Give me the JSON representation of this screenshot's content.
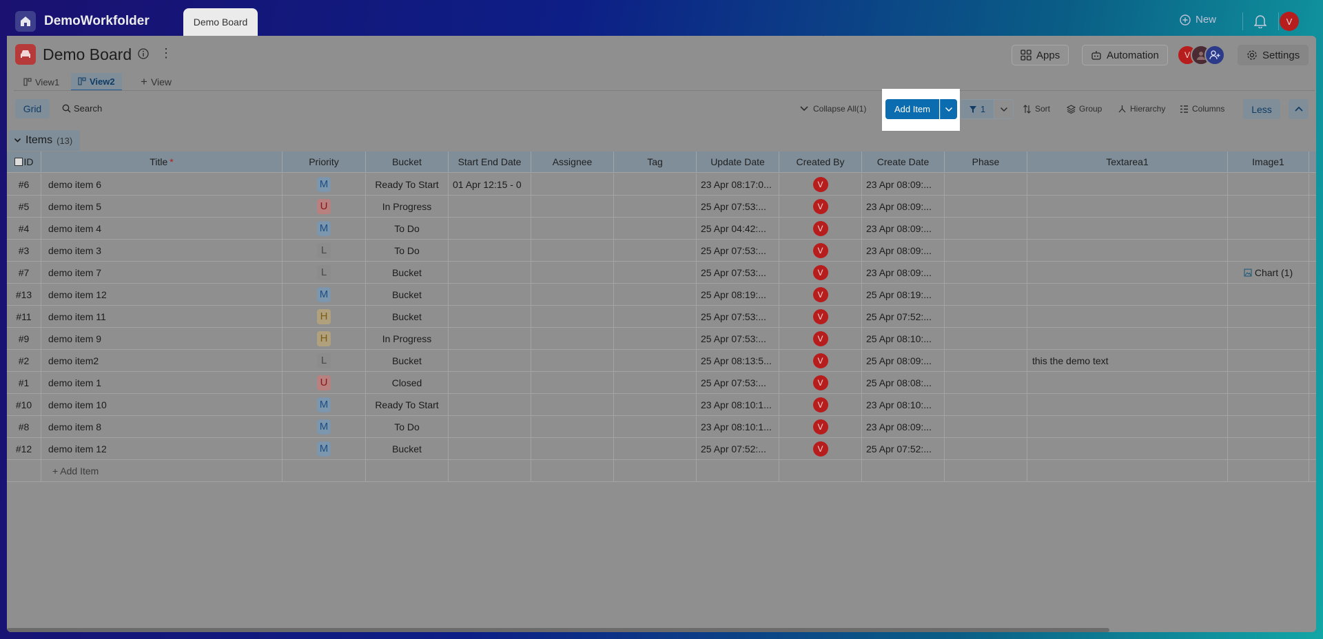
{
  "topbar": {
    "app_title": "DemoWorkfolder",
    "active_tab": "Demo Board",
    "new_label": "New",
    "avatar_letter": "V"
  },
  "board": {
    "title": "Demo Board",
    "apps_label": "Apps",
    "automation_label": "Automation",
    "settings_label": "Settings",
    "avatars": [
      "V",
      "",
      ""
    ]
  },
  "views": {
    "tabs": [
      {
        "label": "View1",
        "active": false
      },
      {
        "label": "View2",
        "active": true
      }
    ],
    "add_view_label": "View"
  },
  "toolbar": {
    "grid_label": "Grid",
    "search_label": "Search",
    "collapse_all_label": "Collapse All(1)",
    "add_item_label": "Add Item",
    "filter_count": "1",
    "sort_label": "Sort",
    "group_label": "Group",
    "hierarchy_label": "Hierarchy",
    "columns_label": "Columns",
    "less_label": "Less"
  },
  "group": {
    "name": "Items",
    "count": "(13)"
  },
  "table": {
    "columns": [
      "ID",
      "Title",
      "Priority",
      "Bucket",
      "Start End Date",
      "Assignee",
      "Tag",
      "Update Date",
      "Created By",
      "Create Date",
      "Phase",
      "Textarea1",
      "Image1"
    ],
    "title_required_mark": "*",
    "rows": [
      {
        "id": "#6",
        "title": "demo item 6",
        "priority": "M",
        "bucket": "Ready To Start",
        "date": "01 Apr 12:15  -  0",
        "update": "23 Apr 08:17:0...",
        "by": "V",
        "create": "23 Apr 08:09:...",
        "text": "",
        "image": ""
      },
      {
        "id": "#5",
        "title": "demo item 5",
        "priority": "U",
        "bucket": "In Progress",
        "date": "",
        "update": "25 Apr 07:53:...",
        "by": "V",
        "create": "23 Apr 08:09:...",
        "text": "",
        "image": ""
      },
      {
        "id": "#4",
        "title": "demo item 4",
        "priority": "M",
        "bucket": "To Do",
        "date": "",
        "update": "25 Apr 04:42:...",
        "by": "V",
        "create": "23 Apr 08:09:...",
        "text": "",
        "image": ""
      },
      {
        "id": "#3",
        "title": "demo item 3",
        "priority": "L",
        "bucket": "To Do",
        "date": "",
        "update": "25 Apr 07:53:...",
        "by": "V",
        "create": "23 Apr 08:09:...",
        "text": "",
        "image": ""
      },
      {
        "id": "#7",
        "title": "demo item 7",
        "priority": "L",
        "bucket": "Bucket",
        "date": "",
        "update": "25 Apr 07:53:...",
        "by": "V",
        "create": "23 Apr 08:09:...",
        "text": "",
        "image": "Chart (1)"
      },
      {
        "id": "#13",
        "title": "demo item 12",
        "priority": "M",
        "bucket": "Bucket",
        "date": "",
        "update": "25 Apr 08:19:...",
        "by": "V",
        "create": "25 Apr 08:19:...",
        "text": "",
        "image": ""
      },
      {
        "id": "#11",
        "title": "demo item 11",
        "priority": "H",
        "bucket": "Bucket",
        "date": "",
        "update": "25 Apr 07:53:...",
        "by": "V",
        "create": "25 Apr 07:52:...",
        "text": "",
        "image": ""
      },
      {
        "id": "#9",
        "title": "demo item 9",
        "priority": "H",
        "bucket": "In Progress",
        "date": "",
        "update": "25 Apr 07:53:...",
        "by": "V",
        "create": "25 Apr 08:10:...",
        "text": "",
        "image": ""
      },
      {
        "id": "#2",
        "title": "demo item2",
        "priority": "L",
        "bucket": "Bucket",
        "date": "",
        "update": "25 Apr 08:13:5...",
        "by": "V",
        "create": "25 Apr 08:09:...",
        "text": "this the demo text",
        "image": ""
      },
      {
        "id": "#1",
        "title": "demo item 1",
        "priority": "U",
        "bucket": "Closed",
        "date": "",
        "update": "25 Apr 07:53:...",
        "by": "V",
        "create": "25 Apr 08:08:...",
        "text": "",
        "image": ""
      },
      {
        "id": "#10",
        "title": "demo item 10",
        "priority": "M",
        "bucket": "Ready To Start",
        "date": "",
        "update": "23 Apr 08:10:1...",
        "by": "V",
        "create": "23 Apr 08:10:...",
        "text": "",
        "image": ""
      },
      {
        "id": "#8",
        "title": "demo item 8",
        "priority": "M",
        "bucket": "To Do",
        "date": "",
        "update": "23 Apr 08:10:1...",
        "by": "V",
        "create": "23 Apr 08:09:...",
        "text": "",
        "image": ""
      },
      {
        "id": "#12",
        "title": "demo item 12",
        "priority": "M",
        "bucket": "Bucket",
        "date": "",
        "update": "25 Apr 07:52:...",
        "by": "V",
        "create": "25 Apr 07:52:...",
        "text": "",
        "image": ""
      }
    ],
    "add_item_row_label": "+ Add Item"
  },
  "colors": {
    "accent": "#0c6cb0",
    "avatar_red": "#b81d1d"
  }
}
